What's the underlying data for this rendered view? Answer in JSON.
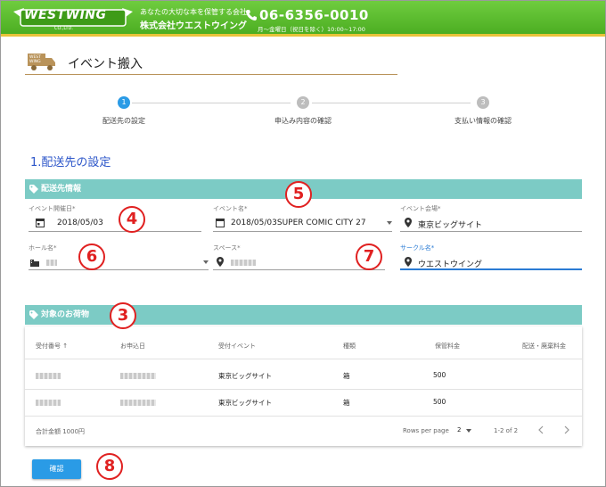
{
  "header": {
    "logo_text": "WESTWING",
    "logo_sub": "CO.,LTD.",
    "tagline": "あなたの大切な本を保管する会社",
    "company": "株式会社ウエストウイング",
    "phone": "06-6356-0010",
    "hours": "月～金曜日（祝日を除く）10:00~17:00",
    "brand_green": "#5bbd2d",
    "accent_yellow": "#e9c33a"
  },
  "page": {
    "truck_text": "WEST WING",
    "title": "イベント搬入"
  },
  "stepper": {
    "steps": [
      {
        "number": "1",
        "label": "配送先の設定",
        "active": true
      },
      {
        "number": "2",
        "label": "申込み内容の確認",
        "active": false
      },
      {
        "number": "3",
        "label": "支払い情報の確認",
        "active": false
      }
    ],
    "active_color": "#2a9be6",
    "inactive_color": "#bdbdbd"
  },
  "section_heading": "1.配送先の設定",
  "delivery_band": {
    "label": "配送先情報",
    "icon": "tag-icon"
  },
  "fields": {
    "event_date": {
      "label": "イベント開催日*",
      "value": "2018/05/03",
      "icon": "calendar-icon"
    },
    "event_name": {
      "label": "イベント名*",
      "value": "2018/05/03SUPER COMIC CITY 27",
      "icon": "calendar-icon"
    },
    "event_venue": {
      "label": "イベント会場*",
      "value": "東京ビッグサイト",
      "icon": "location-pin-icon"
    },
    "hall_name": {
      "label": "ホール名*",
      "value": "",
      "icon": "building-icon"
    },
    "space": {
      "label": "スペース*",
      "value": "",
      "icon": "location-pin-icon"
    },
    "circle_name": {
      "label": "サークル名*",
      "value": "ウエストウイング",
      "icon": "location-pin-icon"
    }
  },
  "badges": [
    "4",
    "5",
    "6",
    "7",
    "3",
    "8"
  ],
  "items_band": {
    "label": "対象のお荷物",
    "icon": "tag-icon"
  },
  "table": {
    "columns": [
      "受付番号 ↑",
      "お申込日",
      "受付イベント",
      "種類",
      "保管料金",
      "配送・廃棄料金"
    ],
    "rows": [
      {
        "event": "東京ビッグサイト",
        "type": "箱",
        "storage_fee": "500"
      },
      {
        "event": "東京ビッグサイト",
        "type": "箱",
        "storage_fee": "500"
      }
    ],
    "total": "合計金額 1000円",
    "rows_per_page_label": "Rows per page",
    "rows_per_page_value": "2",
    "range": "1-2 of 2"
  },
  "confirm_button": "確認"
}
